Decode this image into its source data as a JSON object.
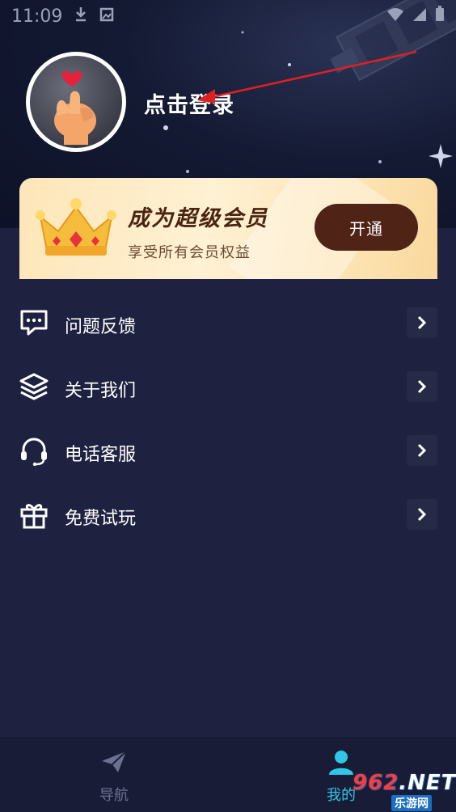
{
  "status_bar": {
    "time": "11:09"
  },
  "header": {
    "login_text": "点击登录"
  },
  "vip": {
    "title": "成为超级会员",
    "subtitle": "享受所有会员权益",
    "button_label": "开通"
  },
  "menu": {
    "items": [
      {
        "label": "问题反馈",
        "icon": "chat-icon"
      },
      {
        "label": "关于我们",
        "icon": "layers-icon"
      },
      {
        "label": "电话客服",
        "icon": "headset-icon"
      },
      {
        "label": "免费试玩",
        "icon": "gift-icon"
      }
    ]
  },
  "tabbar": {
    "tabs": [
      {
        "label": "导航",
        "icon": "paper-plane-icon",
        "active": false
      },
      {
        "label": "我的",
        "icon": "person-icon",
        "active": true
      }
    ]
  },
  "watermark": {
    "text_main": "962",
    "text_suffix": ".NET",
    "text_sub": "乐游网"
  },
  "colors": {
    "background": "#1e2140",
    "vip_button": "#4f2417",
    "active_tab": "#2fc6e8",
    "annotation_arrow": "#e02020"
  }
}
